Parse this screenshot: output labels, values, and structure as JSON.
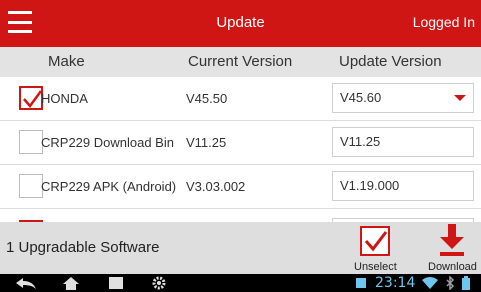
{
  "header": {
    "title": "Update",
    "status": "Logged In"
  },
  "columns": {
    "make": "Make",
    "current": "Current Version",
    "update": "Update Version"
  },
  "rows": [
    {
      "checked": true,
      "make": "HONDA",
      "current": "V45.50",
      "update": "V45.60",
      "has_dropdown": true
    },
    {
      "checked": false,
      "make": "CRP229 Download Bin",
      "current": "V11.25",
      "update": "V11.25",
      "has_dropdown": false
    },
    {
      "checked": false,
      "make": "CRP229 APK (Android)",
      "current": "V3.03.002",
      "update": "V1.19.000",
      "has_dropdown": false
    }
  ],
  "footer": {
    "summary": "1 Upgradable Software",
    "unselect_label": "Unselect",
    "download_label": "Download"
  },
  "system_bar": {
    "time": "23:14"
  },
  "colors": {
    "accent": "#d01515",
    "header_bg": "#d01515",
    "column_header_bg": "#e3e3e3",
    "footer_bg": "#dedede",
    "clock": "#6ec6f0"
  }
}
